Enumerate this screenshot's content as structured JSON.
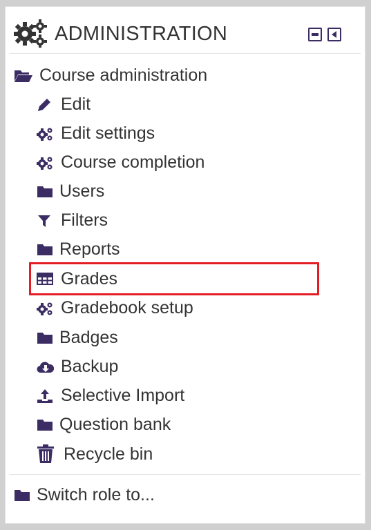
{
  "block": {
    "title": "ADMINISTRATION",
    "title_icon": "gears-icon",
    "controls": [
      {
        "name": "collapse-icon",
        "action": "collapse"
      },
      {
        "name": "dock-icon",
        "action": "dock"
      }
    ]
  },
  "tree": {
    "root": {
      "label": "Course administration",
      "icon": "folder-open-icon"
    },
    "items": [
      {
        "label": "Edit",
        "icon": "pencil-icon"
      },
      {
        "label": "Edit settings",
        "icon": "gears-icon"
      },
      {
        "label": "Course completion",
        "icon": "gears-icon"
      },
      {
        "label": "Users",
        "icon": "folder-icon"
      },
      {
        "label": "Filters",
        "icon": "filter-icon"
      },
      {
        "label": "Reports",
        "icon": "folder-icon"
      },
      {
        "label": "Grades",
        "icon": "table-icon",
        "highlighted": true
      },
      {
        "label": "Gradebook setup",
        "icon": "gears-icon"
      },
      {
        "label": "Badges",
        "icon": "folder-icon"
      },
      {
        "label": "Backup",
        "icon": "cloud-download-icon"
      },
      {
        "label": "Selective Import",
        "icon": "upload-icon"
      },
      {
        "label": "Question bank",
        "icon": "folder-icon"
      },
      {
        "label": "Recycle bin",
        "icon": "trash-icon"
      }
    ],
    "footer": {
      "label": "Switch role to...",
      "icon": "folder-icon"
    }
  },
  "colors": {
    "icon": "#3b2c63",
    "text": "#333333",
    "highlight": "#e51c24"
  }
}
